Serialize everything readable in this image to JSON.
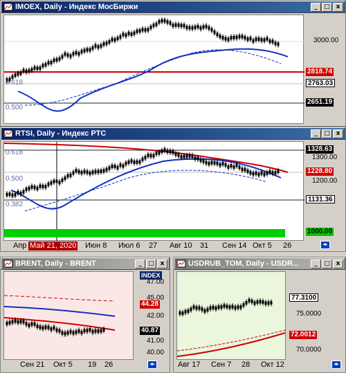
{
  "windows": {
    "imoex": {
      "title": "IMOEX, Daily - Индекс МосБиржи",
      "price_levels": [
        "3000.00"
      ],
      "tags": {
        "red": "2818.74",
        "last": "2763.03",
        "level": "2651.19"
      },
      "fib": [
        "0.618",
        "0.500"
      ]
    },
    "rtsi": {
      "title": "RTSI, Daily - Индекс РТС",
      "price_levels": [
        "1300.00",
        "1200.00"
      ],
      "tags": {
        "top": "1328.63",
        "red": "1228.80",
        "last": "1131.36",
        "green": "1000.00"
      },
      "fib": [
        "0.618",
        "0.500",
        "0.382"
      ],
      "x_axis": [
        "Апр",
        "Июн 8",
        "Июл 6",
        "27",
        "Авг 10",
        "31",
        "Сен 14",
        "Окт 5",
        "26"
      ],
      "crosshair_date": "Май 21, 2020"
    },
    "brent": {
      "title": "BRENT, Daily - BRENT",
      "index_label": "INDEX",
      "price_levels": [
        "47.00",
        "45.00",
        "42.00",
        "41.00",
        "40.00"
      ],
      "tags": {
        "red": "44.28",
        "last": "40.87"
      },
      "x_axis": [
        "Сен 21",
        "Окт 5",
        "19",
        "26"
      ]
    },
    "usdrub": {
      "title": "USDRUB_TOM, Daily - USDR...",
      "price_levels": [
        "75.0000",
        "70.0000"
      ],
      "tags": {
        "last": "77.3100",
        "red": "72.0012"
      },
      "x_axis": [
        "Авг 17",
        "Сен 7",
        "28",
        "Окт 12"
      ]
    }
  },
  "buttons": {
    "minimize": "_",
    "maximize": "□",
    "close": "x"
  },
  "colors": {
    "title_active": "#0a246a",
    "title_inactive": "#7a7a7a",
    "ma_red": "#d00000",
    "ma_blue": "#1030c0",
    "candle_green": "#00c000"
  }
}
